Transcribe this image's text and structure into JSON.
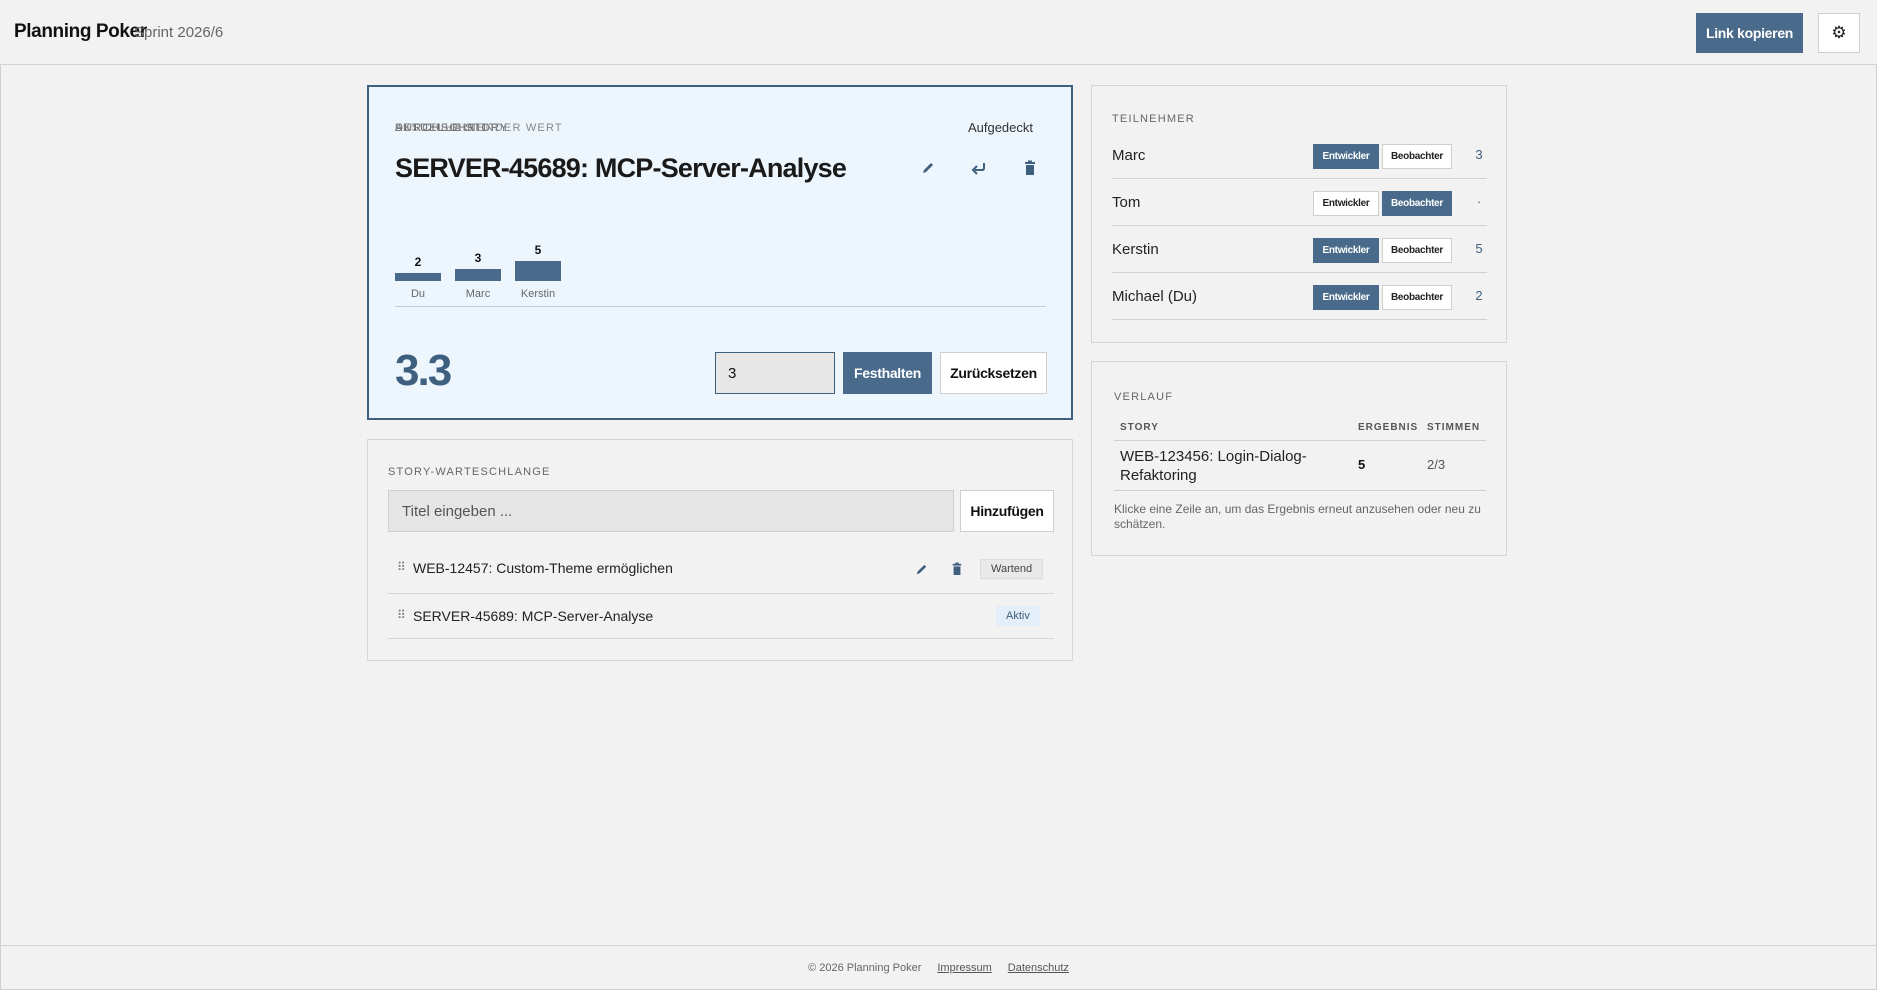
{
  "header": {
    "app_title": "Planning Poker",
    "sprint": "Sprint 2026/6",
    "copy_link_label": "Link kopieren",
    "settings_icon": "gear-icon"
  },
  "current_story": {
    "section_label": "AKTUELLE STORY",
    "status": "Aufgedeckt",
    "title": "SERVER-45689: MCP-Server-Analyse",
    "votes": [
      {
        "name": "Du",
        "value": "2"
      },
      {
        "name": "Marc",
        "value": "3"
      },
      {
        "name": "Kerstin",
        "value": "5"
      }
    ],
    "average_label": "DURCHSCHNITT",
    "average_value": "3.3",
    "fix_label": "FESTZUHALTENDER WERT",
    "fix_value": "3",
    "fix_button": "Festhalten",
    "reset_button": "Zurücksetzen"
  },
  "queue": {
    "section_label": "STORY-WARTESCHLANGE",
    "input_placeholder": "Titel eingeben ...",
    "add_button": "Hinzufügen",
    "items": [
      {
        "title": "WEB-12457: Custom-Theme ermöglichen",
        "status": "Wartend"
      },
      {
        "title": "SERVER-45689: MCP-Server-Analyse",
        "status": "Aktiv"
      }
    ]
  },
  "participants": {
    "section_label": "TEILNEHMER",
    "role_dev": "Entwickler",
    "role_obs": "Beobachter",
    "items": [
      {
        "name": "Marc",
        "role": "dev",
        "vote": "3"
      },
      {
        "name": "Tom",
        "role": "obs",
        "vote": "·"
      },
      {
        "name": "Kerstin",
        "role": "dev",
        "vote": "5"
      },
      {
        "name": "Michael (Du)",
        "role": "dev",
        "vote": "2"
      }
    ]
  },
  "history": {
    "section_label": "VERLAUF",
    "col_story": "STORY",
    "col_result": "ERGEBNIS",
    "col_votes": "STIMMEN",
    "rows": [
      {
        "story": "WEB-123456: Login-Dialog-Refaktoring",
        "result": "5",
        "votes": "2/3"
      }
    ],
    "hint": "Klicke eine Zeile an, um das Ergebnis erneut anzusehen oder neu zu schätzen."
  },
  "footer": {
    "copyright": "© 2026 Planning Poker",
    "imprint": "Impressum",
    "privacy": "Datenschutz"
  },
  "colors": {
    "accent": "#496a8a",
    "story_bg": "#edf5fd"
  }
}
